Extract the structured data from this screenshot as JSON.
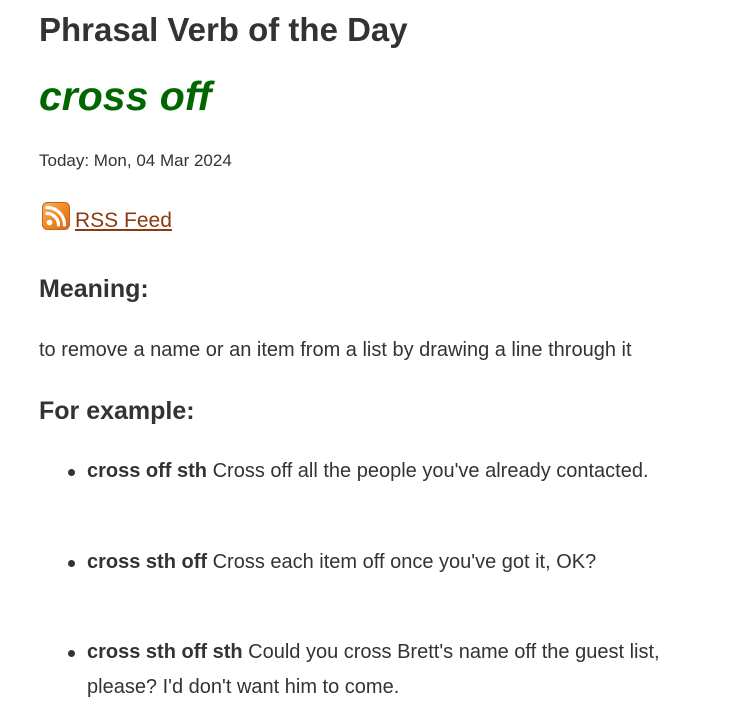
{
  "header": {
    "title": "Phrasal Verb of the Day",
    "verb": "cross off",
    "today_label": "Today: Mon, 04 Mar 2024"
  },
  "rss": {
    "icon": "rss-feed-icon",
    "label": "RSS Feed"
  },
  "meaning": {
    "heading": "Meaning:",
    "text": "to remove a name or an item from a list by drawing a line through it"
  },
  "examples": {
    "heading": "For example:",
    "items": [
      {
        "pattern": "cross off sth",
        "sentence": "Cross off all the people you've already contacted."
      },
      {
        "pattern": "cross sth off",
        "sentence": "Cross each item off once you've got it, OK?"
      },
      {
        "pattern": "cross sth off sth",
        "sentence": "Could you cross Brett's name off the guest list, please? I'd don't want him to come."
      }
    ]
  },
  "colors": {
    "verb": "#006600",
    "link": "#8b3a0f",
    "text": "#333333",
    "rss_orange": "#f08a24"
  }
}
